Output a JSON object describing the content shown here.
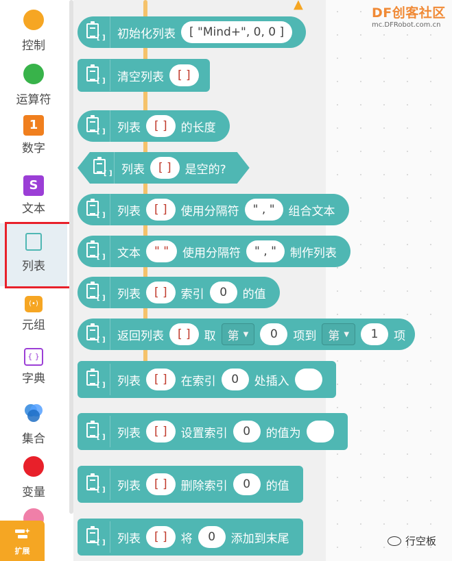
{
  "categories": [
    {
      "label": "控制",
      "icon": "orange-circle-icon",
      "color": "#f6a623"
    },
    {
      "label": "运算符",
      "icon": "green-circle-icon",
      "color": "#38b34a"
    },
    {
      "label": "数字",
      "icon": "number-one-icon",
      "color": "#f07f1e",
      "glyph": "1"
    },
    {
      "label": "文本",
      "icon": "text-s-icon",
      "color": "#9b3ed6",
      "glyph": "S"
    },
    {
      "label": "列表",
      "icon": "list-clipboard-icon",
      "color": "#4fb7b3"
    },
    {
      "label": "元组",
      "icon": "tuple-lock-icon",
      "color": "#f6a623"
    },
    {
      "label": "字典",
      "icon": "dictionary-braces-icon",
      "color": "#9b3ed6"
    },
    {
      "label": "集合",
      "icon": "set-venn-icon",
      "color": "#2e86de"
    },
    {
      "label": "变量",
      "icon": "red-circle-icon",
      "color": "#e8202a"
    }
  ],
  "extension": {
    "label": "扩展"
  },
  "logo": {
    "main": "DF创客社区",
    "sub": "mc.DFRobot.com.cn"
  },
  "watermark": {
    "text": "行空板"
  },
  "blocks": {
    "b1": {
      "t1": "初始化列表",
      "s1": "[ \"Mind+\", 0, 0 ]"
    },
    "b2": {
      "t1": "清空列表",
      "s1": "[    ]"
    },
    "b3": {
      "t1": "列表",
      "s1": "[    ]",
      "t2": "的长度"
    },
    "b4": {
      "t1": "列表",
      "s1": "[    ]",
      "t2": "是空的?"
    },
    "b5": {
      "t1": "列表",
      "s1": "[    ]",
      "t2": "使用分隔符",
      "s2": "\" , \"",
      "t3": "组合文本"
    },
    "b6": {
      "t1": "文本",
      "s1": "\"    \"",
      "t2": "使用分隔符",
      "s2": "\" , \"",
      "t3": "制作列表"
    },
    "b7": {
      "t1": "列表",
      "s1": "[    ]",
      "t2": "索引",
      "n1": "0",
      "t3": "的值"
    },
    "b8": {
      "t1": "返回列表",
      "s1": "[    ]",
      "t2": "取",
      "d1": "第",
      "n1": "0",
      "t3": "项到",
      "d2": "第",
      "n2": "1",
      "t4": "项"
    },
    "b9": {
      "t1": "列表",
      "s1": "[    ]",
      "t2": "在索引",
      "n1": "0",
      "t3": "处插入"
    },
    "b10": {
      "t1": "列表",
      "s1": "[    ]",
      "t2": "设置索引",
      "n1": "0",
      "t3": "的值为"
    },
    "b11": {
      "t1": "列表",
      "s1": "[    ]",
      "t2": "删除索引",
      "n1": "0",
      "t3": "的值"
    },
    "b12": {
      "t1": "列表",
      "s1": "[    ]",
      "t2": "将",
      "n1": "0",
      "t3": "添加到末尾"
    }
  }
}
